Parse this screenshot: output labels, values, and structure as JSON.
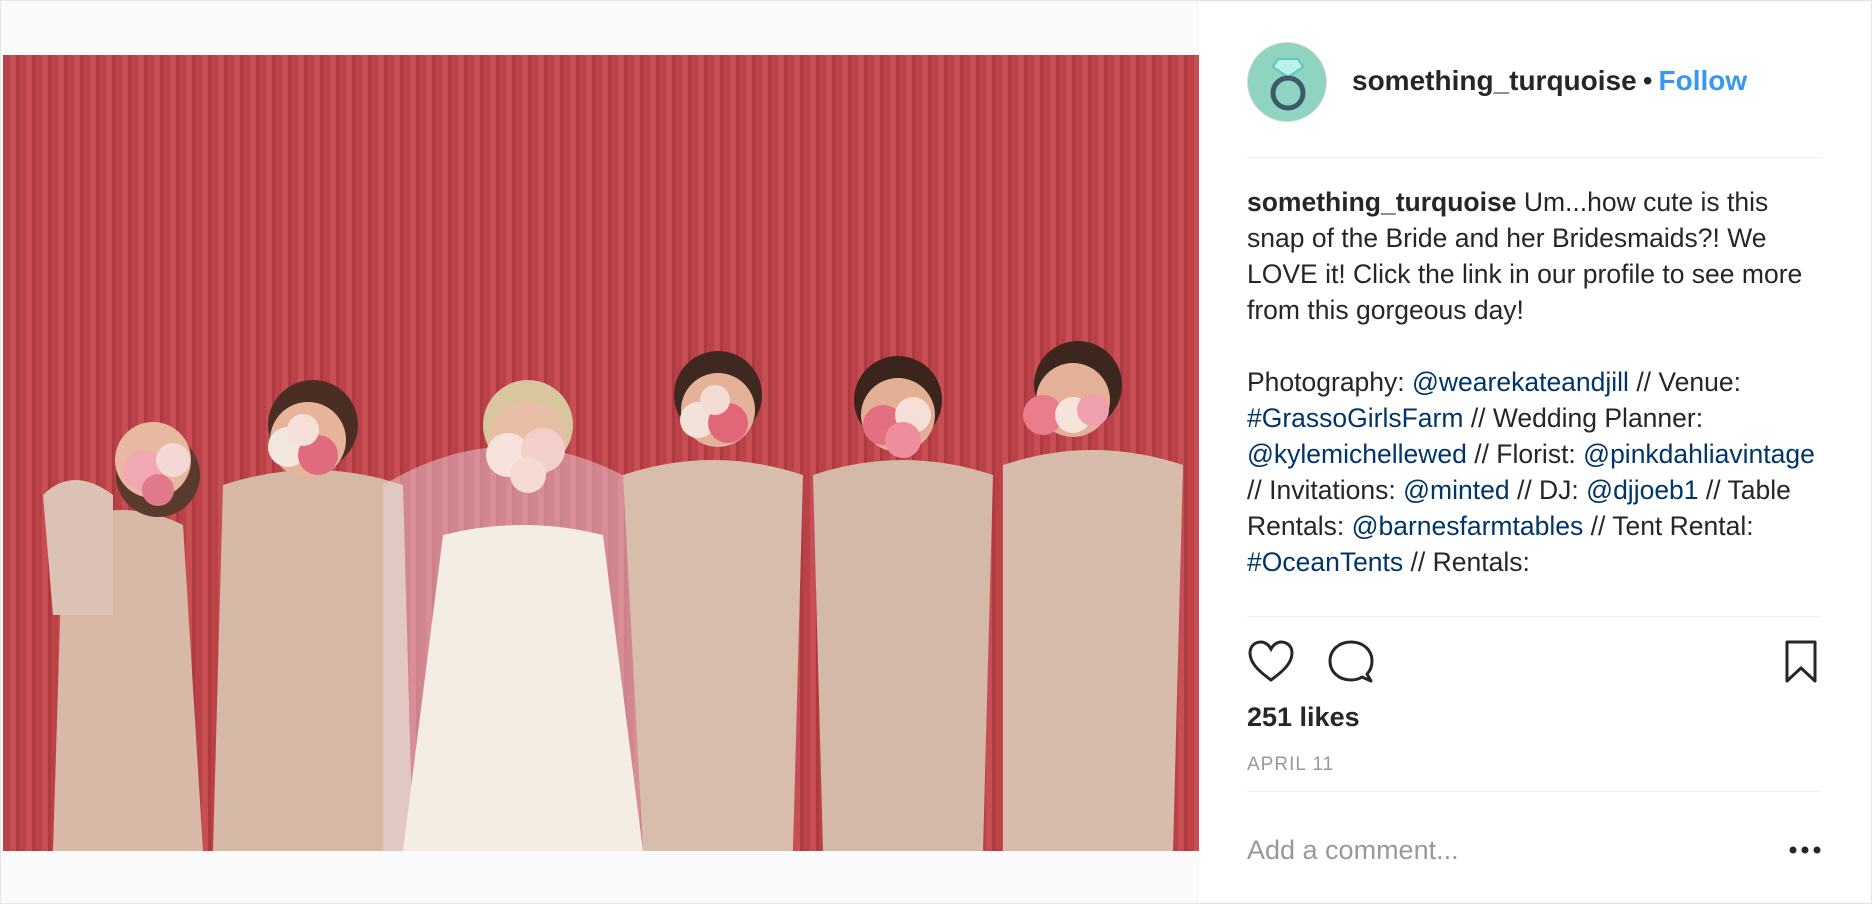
{
  "post": {
    "username": "something_turquoise",
    "separator": "•",
    "follow_label": "Follow",
    "photo_description": "Bride and bridesmaids holding bouquets in front of a red corrugated wall",
    "caption": {
      "author": "something_turquoise",
      "text": " Um...how cute is this snap of the Bride and her Bridesmaids?! We LOVE it! Click the link in our profile to see more from this gorgeous day!",
      "credits": [
        {
          "text": "Photography: "
        },
        {
          "tag": "@wearekateandjill"
        },
        {
          "text": " // Venue: "
        },
        {
          "tag": "#GrassoGirlsFarm"
        },
        {
          "text": " // Wedding Planner: "
        },
        {
          "tag": "@kylemichellewed"
        },
        {
          "text": " // Florist: "
        },
        {
          "tag": "@pinkdahliavintage"
        },
        {
          "text": " // Invitations: "
        },
        {
          "tag": "@minted"
        },
        {
          "text": " // DJ: "
        },
        {
          "tag": "@djjoeb1"
        },
        {
          "text": " // Table Rentals: "
        },
        {
          "tag": "@barnesfarmtables"
        },
        {
          "text": " // Tent Rental: "
        },
        {
          "tag": "#OceanTents"
        },
        {
          "text": " // Rentals:"
        }
      ]
    },
    "likes": "251 likes",
    "date": "APRIL 11",
    "comment_placeholder": "Add a comment..."
  },
  "icons": {
    "avatar": "ring-icon",
    "like": "heart-icon",
    "comment": "comment-bubble-icon",
    "save": "bookmark-icon",
    "more": "ellipsis-icon"
  },
  "colors": {
    "follow": "#3897f0",
    "tag": "#003569",
    "avatar_bg": "#8fd4c0",
    "wall": "#c2444a"
  }
}
